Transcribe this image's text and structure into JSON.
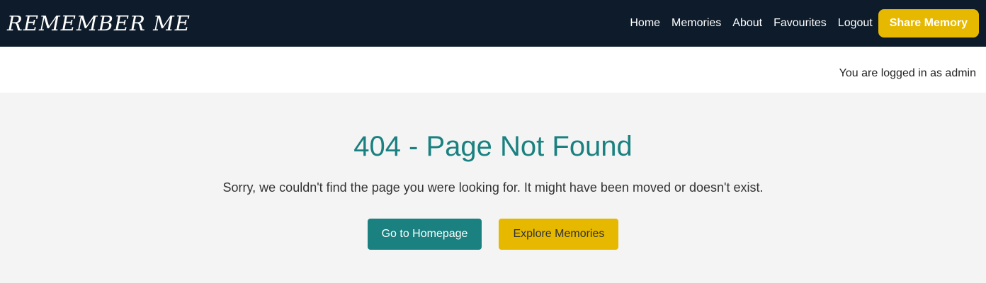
{
  "brand": {
    "name": "REMEMBER ME"
  },
  "nav": {
    "links": [
      "Home",
      "Memories",
      "About",
      "Favourites",
      "Logout"
    ],
    "cta_label": "Share Memory"
  },
  "session": {
    "status_text": "You are logged in as admin"
  },
  "error": {
    "title": "404 - Page Not Found",
    "message": "Sorry, we couldn't find the page you were looking for. It might have been moved or doesn't exist.",
    "primary_action": "Go to Homepage",
    "secondary_action": "Explore Memories"
  },
  "colors": {
    "nav_bg": "#0d1b2a",
    "accent_teal": "#1a8080",
    "accent_yellow": "#e6b800",
    "page_bg": "#f4f4f4"
  }
}
